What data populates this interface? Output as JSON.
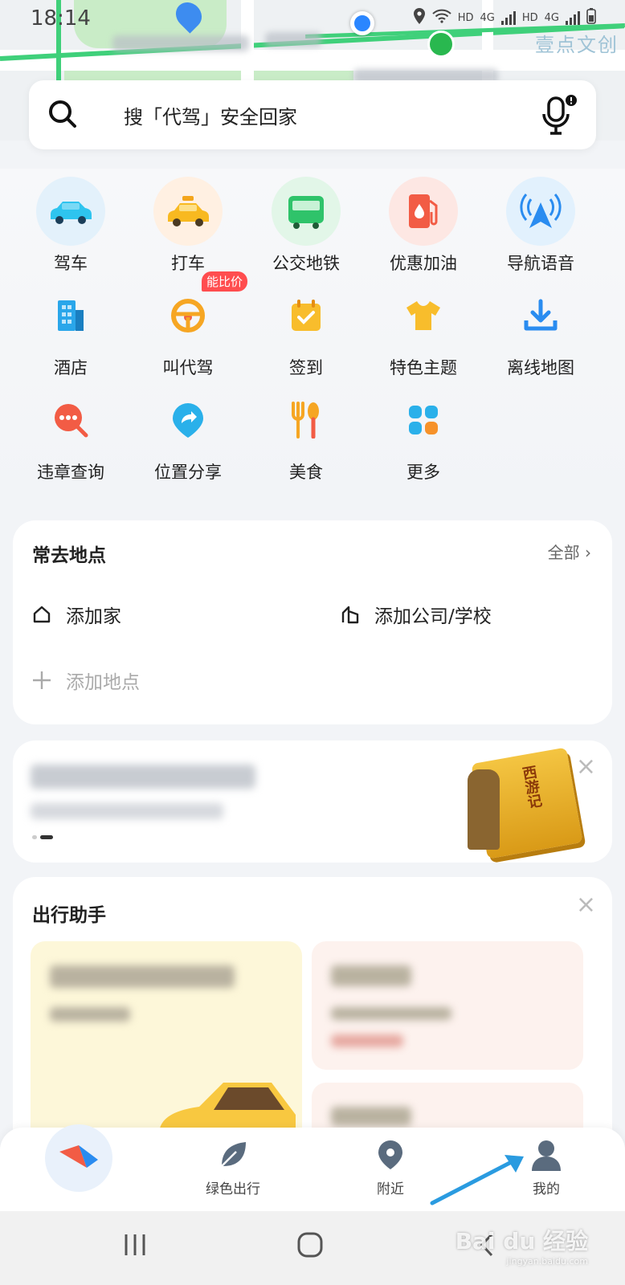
{
  "status": {
    "time": "18:14",
    "net1": "HD",
    "net2": "4G",
    "net3": "HD",
    "net4": "4G"
  },
  "map": {
    "label": "壹点文创"
  },
  "search": {
    "placeholder": "搜「代驾」安全回家"
  },
  "grid": [
    {
      "label": "驾车",
      "icon": "car-icon"
    },
    {
      "label": "打车",
      "icon": "taxi-icon"
    },
    {
      "label": "公交地铁",
      "icon": "bus-icon"
    },
    {
      "label": "优惠加油",
      "icon": "fuel-icon"
    },
    {
      "label": "导航语音",
      "icon": "voice-nav-icon"
    },
    {
      "label": "酒店",
      "icon": "hotel-icon"
    },
    {
      "label": "叫代驾",
      "icon": "steering-wheel-icon",
      "badge": "能比价"
    },
    {
      "label": "签到",
      "icon": "checkin-icon"
    },
    {
      "label": "特色主题",
      "icon": "tshirt-icon"
    },
    {
      "label": "离线地图",
      "icon": "download-icon"
    },
    {
      "label": "违章查询",
      "icon": "violation-search-icon"
    },
    {
      "label": "位置分享",
      "icon": "share-location-icon"
    },
    {
      "label": "美食",
      "icon": "food-icon"
    },
    {
      "label": "更多",
      "icon": "more-grid-icon"
    }
  ],
  "favorites": {
    "title": "常去地点",
    "all": "全部",
    "home": "添加家",
    "work": "添加公司/学校",
    "add": "添加地点"
  },
  "banner": {
    "book_title": "西游记"
  },
  "assistant": {
    "title": "出行助手"
  },
  "nav": {
    "green": "绿色出行",
    "nearby": "附近",
    "mine": "我的"
  },
  "watermark": {
    "brand": "Bai du 经验",
    "url": "jingyan.baidu.com"
  },
  "colors": {
    "accent": "#2a86ff",
    "badge": "#ff4d4f",
    "green_road": "#3fd07a"
  }
}
